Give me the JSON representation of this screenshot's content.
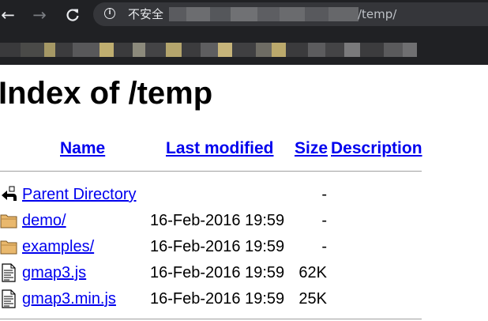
{
  "browser": {
    "nav": {
      "back_icon": "arrow-left-icon",
      "forward_icon": "arrow-right-icon",
      "reload_icon": "reload-icon"
    },
    "address_bar": {
      "security_icon": "info-icon",
      "security_label": "不安全",
      "url_path": "/temp/"
    }
  },
  "page": {
    "title": "Index of /temp",
    "columns": {
      "name": "Name",
      "last_modified": "Last modified",
      "size": "Size",
      "description": "Description"
    },
    "entries": [
      {
        "icon": "parent-directory-icon",
        "name": "Parent Directory",
        "modified": "",
        "size": "-"
      },
      {
        "icon": "folder-icon",
        "name": "demo/",
        "modified": "16-Feb-2016 19:59",
        "size": "-"
      },
      {
        "icon": "folder-icon",
        "name": "examples/",
        "modified": "16-Feb-2016 19:59",
        "size": "-"
      },
      {
        "icon": "file-icon",
        "name": "gmap3.js",
        "modified": "16-Feb-2016 19:59",
        "size": "62K"
      },
      {
        "icon": "file-icon",
        "name": "gmap3.min.js",
        "modified": "16-Feb-2016 19:59",
        "size": "25K"
      }
    ]
  },
  "colors": {
    "chrome_bg": "#202124",
    "omnibox_bg": "#35363a",
    "link": "#0000ee"
  }
}
